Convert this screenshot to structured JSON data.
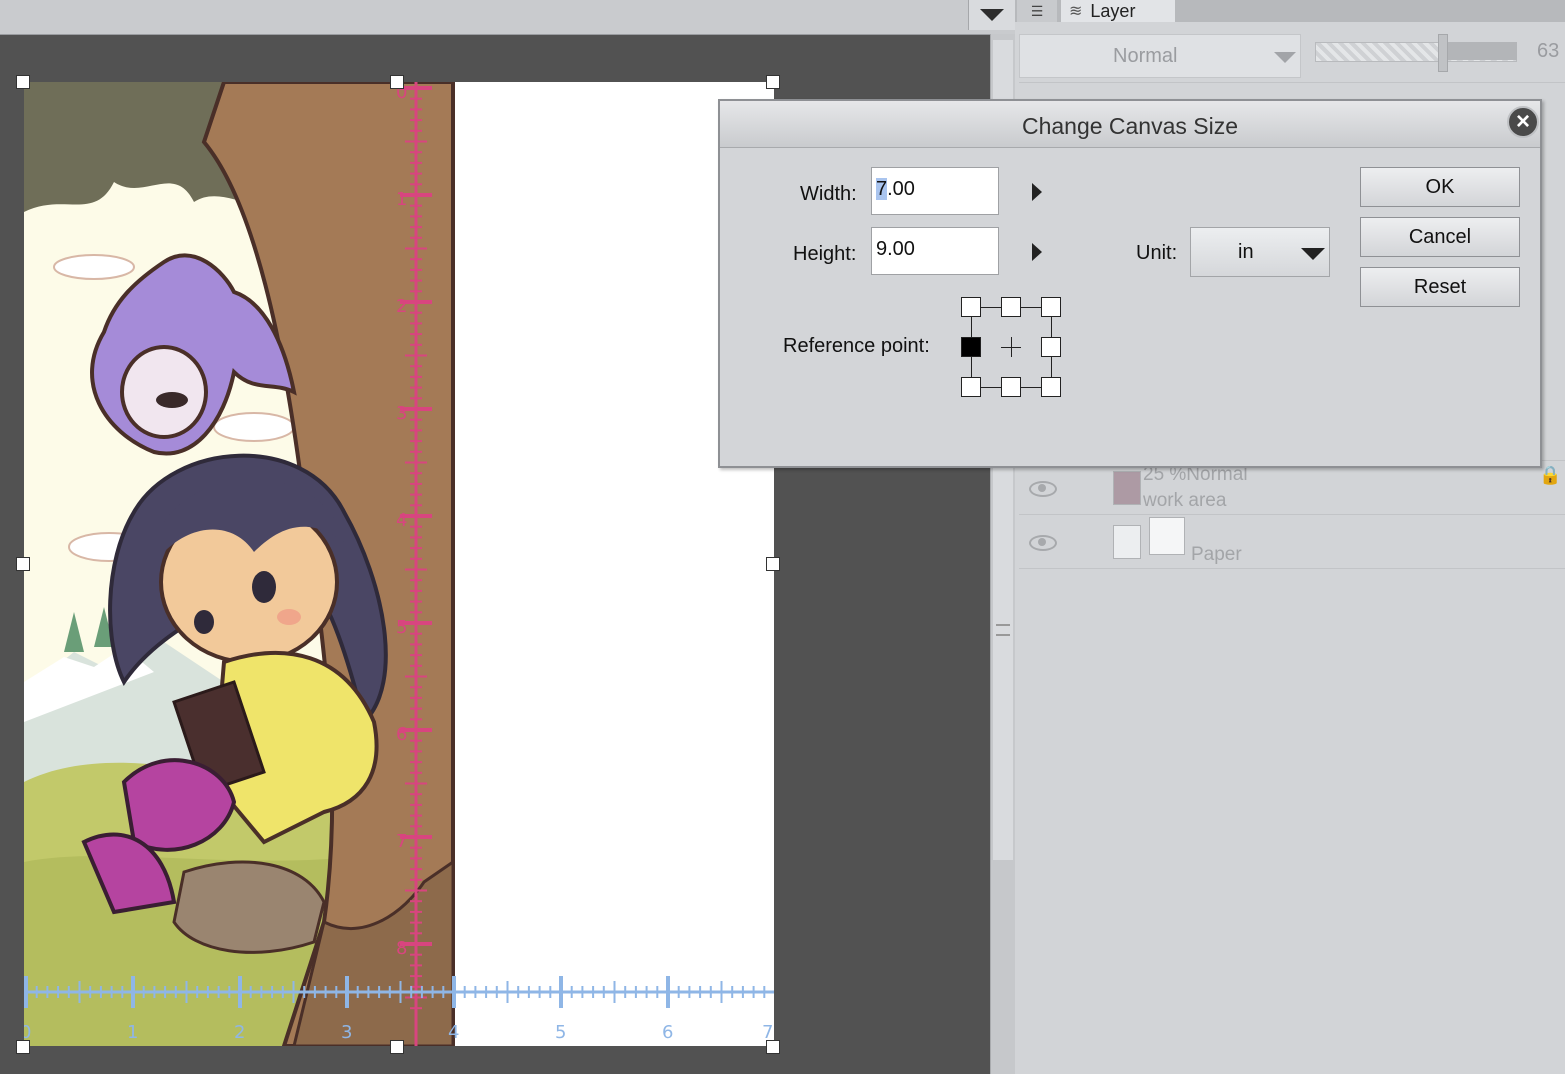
{
  "dialog": {
    "title": "Change Canvas Size",
    "width_label": "Width:",
    "width_value": "7.00",
    "height_label": "Height:",
    "height_value": "9.00",
    "unit_label": "Unit:",
    "unit_value": "in",
    "reference_label": "Reference point:",
    "reference_point": "middle-left",
    "ok": "OK",
    "cancel": "Cancel",
    "reset": "Reset"
  },
  "layer_panel": {
    "tab_label": "Layer",
    "blend_mode": "Normal",
    "opacity_value": "63",
    "layers": [
      {
        "line1": "25 %Normal",
        "line2": "work area"
      },
      {
        "line1": "",
        "line2": "Paper"
      }
    ]
  },
  "ruler": {
    "vertical_ticks": [
      "0",
      "1",
      "2",
      "3",
      "4",
      "5",
      "6",
      "7",
      "8"
    ],
    "horizontal_ticks": [
      "0",
      "1",
      "2",
      "3",
      "4",
      "5",
      "6",
      "7"
    ]
  },
  "colors": {
    "ruler_vertical": "#d8457f",
    "ruler_horizontal": "#8fb6e6"
  }
}
